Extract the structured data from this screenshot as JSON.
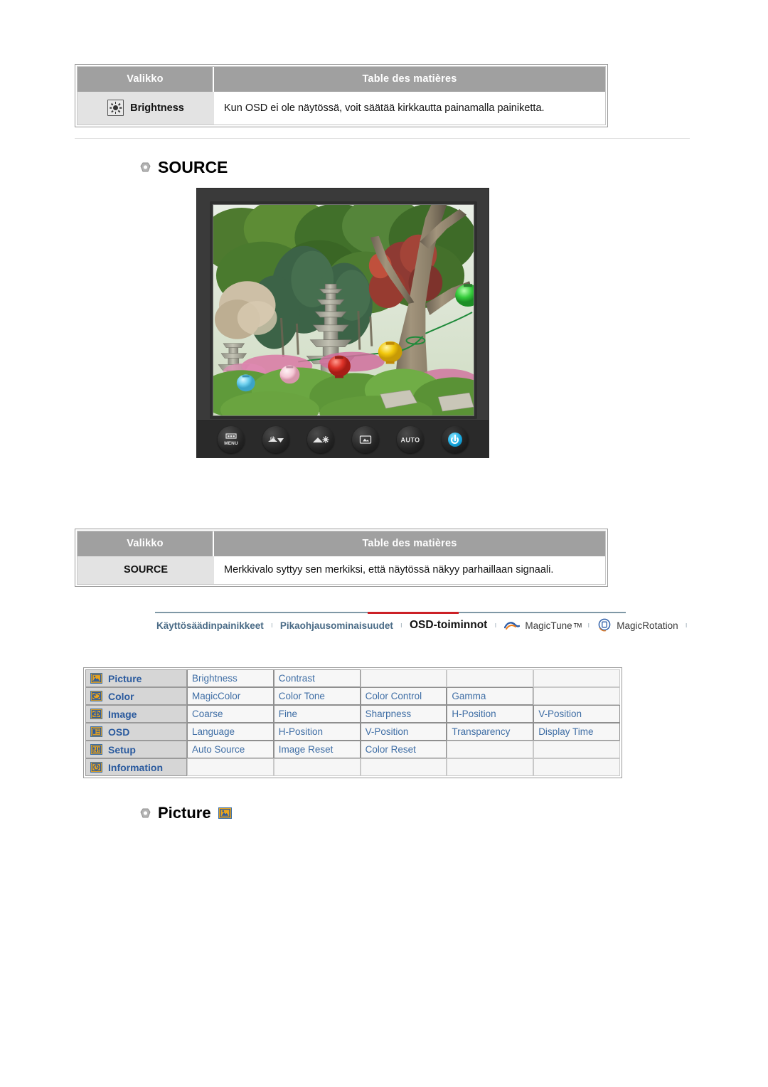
{
  "page": {
    "language": "fi",
    "background": "#ffffff"
  },
  "tables": [
    {
      "id": "brightness-table",
      "headers": {
        "left": "Valikko",
        "right": "Table des matières"
      },
      "row": {
        "icon": "brightness-icon",
        "label": "Brightness",
        "description": "Kun OSD ei ole näytössä, voit säätää kirkkautta painamalla painiketta."
      }
    },
    {
      "id": "source-table",
      "headers": {
        "left": "Valikko",
        "right": "Table des matières"
      },
      "row": {
        "icon": "",
        "label": "SOURCE",
        "description": "Merkkivalo syttyy sen merkiksi, että näytössä näkyy parhaillaan signaali."
      }
    }
  ],
  "headings": [
    {
      "id": "source-heading",
      "text": "SOURCE",
      "bullet": "hex-bullet-icon",
      "has_icon": false
    },
    {
      "id": "picture-heading",
      "text": "Picture",
      "bullet": "hex-bullet-icon",
      "has_icon": true,
      "icon": "picture-icon"
    }
  ],
  "monitor": {
    "screen_alt": "Puutarhanäkymä: kivipagodi, puita ja värikkäitä paperilyhtyjä",
    "buttons": [
      {
        "name": "menu-button",
        "label": "MENU",
        "glyph": "menu-icon"
      },
      {
        "name": "down-button",
        "label": "",
        "glyph": "down-arrow-icon"
      },
      {
        "name": "up-brightness-button",
        "label": "",
        "glyph": "up-brightness-icon"
      },
      {
        "name": "enter-source-button",
        "label": "",
        "glyph": "enter-icon"
      },
      {
        "name": "auto-button",
        "label": "AUTO",
        "glyph": "auto-icon"
      },
      {
        "name": "power-button",
        "label": "",
        "glyph": "power-icon"
      }
    ]
  },
  "navbar": {
    "rule_color": "#7f98a6",
    "active_color": "#cc2026",
    "separator": "ı",
    "items": [
      {
        "label": "Käyttösäädinpainikkeet",
        "active": false,
        "icon": null,
        "style": "link"
      },
      {
        "label": "Pikaohjausominaisuudet",
        "active": false,
        "icon": null,
        "style": "link"
      },
      {
        "label": "OSD-toiminnot",
        "active": true,
        "icon": null,
        "style": "active"
      },
      {
        "label": "MagicTune",
        "active": false,
        "icon": "magictune-logo-icon",
        "style": "plain",
        "superscript": "TM"
      },
      {
        "label": "MagicRotation",
        "active": false,
        "icon": "magicrotation-logo-icon",
        "style": "plain"
      }
    ]
  },
  "osd_grid": {
    "rows": [
      {
        "icon": "picture-icon",
        "category": "Picture",
        "items": [
          "Brightness",
          "Contrast",
          "",
          "",
          ""
        ]
      },
      {
        "icon": "color-icon",
        "category": "Color",
        "items": [
          "MagicColor",
          "Color Tone",
          "Color Control",
          "Gamma",
          ""
        ]
      },
      {
        "icon": "image-icon",
        "category": "Image",
        "items": [
          "Coarse",
          "Fine",
          "Sharpness",
          "H-Position",
          "V-Position"
        ]
      },
      {
        "icon": "osd-icon",
        "category": "OSD",
        "items": [
          "Language",
          "H-Position",
          "V-Position",
          "Transparency",
          "Display Time"
        ]
      },
      {
        "icon": "setup-icon",
        "category": "Setup",
        "items": [
          "Auto Source",
          "Image Reset",
          "Color Reset",
          "",
          ""
        ]
      },
      {
        "icon": "information-icon",
        "category": "Information",
        "items": [
          "",
          "",
          "",
          "",
          ""
        ]
      }
    ],
    "colors": {
      "category_bg": "#d6d6d6",
      "category_text": "#2a5a9e",
      "cell_text": "#3f6ea5",
      "icon_fill": "#e8a41e",
      "icon_border": "#3b6ea5"
    }
  }
}
